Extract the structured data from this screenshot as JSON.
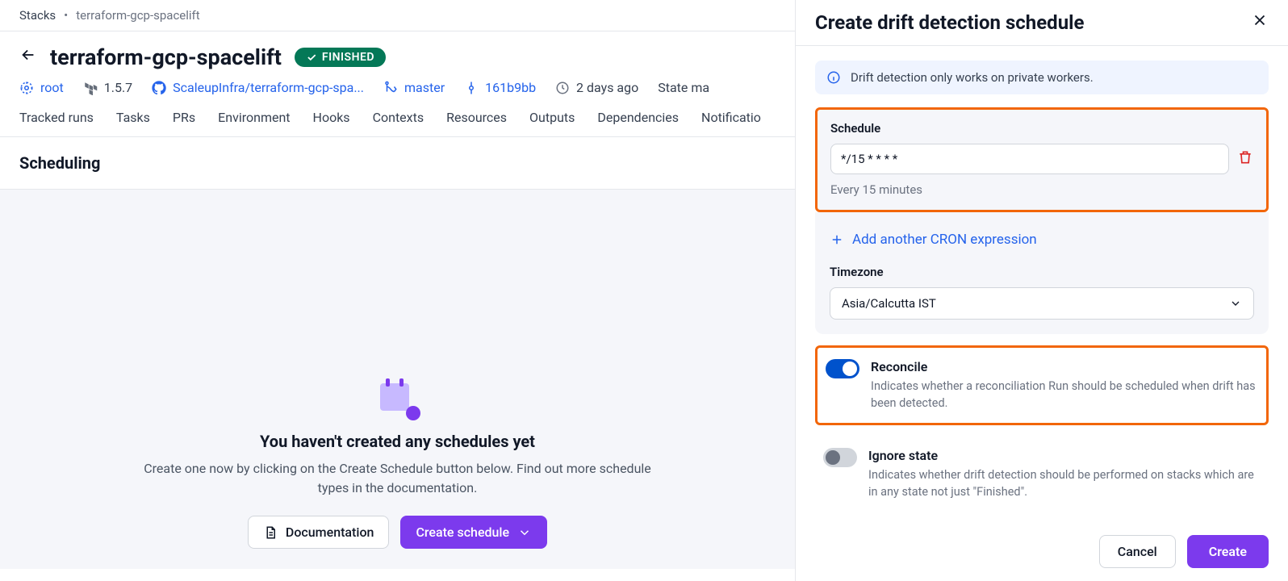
{
  "breadcrumb": {
    "root": "Stacks",
    "current": "terraform-gcp-spacelift"
  },
  "header": {
    "title": "terraform-gcp-spacelift",
    "status_label": "FINISHED",
    "meta": {
      "root": "root",
      "version": "1.5.7",
      "repo": "ScaleupInfra/terraform-gcp-spa...",
      "branch": "master",
      "commit": "161b9bb",
      "age": "2 days ago",
      "state": "State ma"
    }
  },
  "tabs": [
    "Tracked runs",
    "Tasks",
    "PRs",
    "Environment",
    "Hooks",
    "Contexts",
    "Resources",
    "Outputs",
    "Dependencies",
    "Notificatio"
  ],
  "section": {
    "title": "Scheduling"
  },
  "empty": {
    "title": "You haven't created any schedules yet",
    "desc": "Create one now by clicking on the Create Schedule button below. Find out more schedule types in the documentation.",
    "doc_btn": "Documentation",
    "create_btn": "Create schedule"
  },
  "panel": {
    "title": "Create drift detection schedule",
    "info": "Drift detection only works on private workers.",
    "schedule_label": "Schedule",
    "schedule_value": "*/15 * * * *",
    "schedule_hint": "Every 15 minutes",
    "add_cron": "Add another CRON expression",
    "tz_label": "Timezone",
    "tz_value": "Asia/Calcutta IST",
    "reconcile": {
      "title": "Reconcile",
      "desc": "Indicates whether a reconciliation Run should be scheduled when drift has been detected."
    },
    "ignore": {
      "title": "Ignore state",
      "desc": "Indicates whether drift detection should be performed on stacks which are in any state not just \"Finished\"."
    },
    "cancel": "Cancel",
    "create": "Create"
  }
}
